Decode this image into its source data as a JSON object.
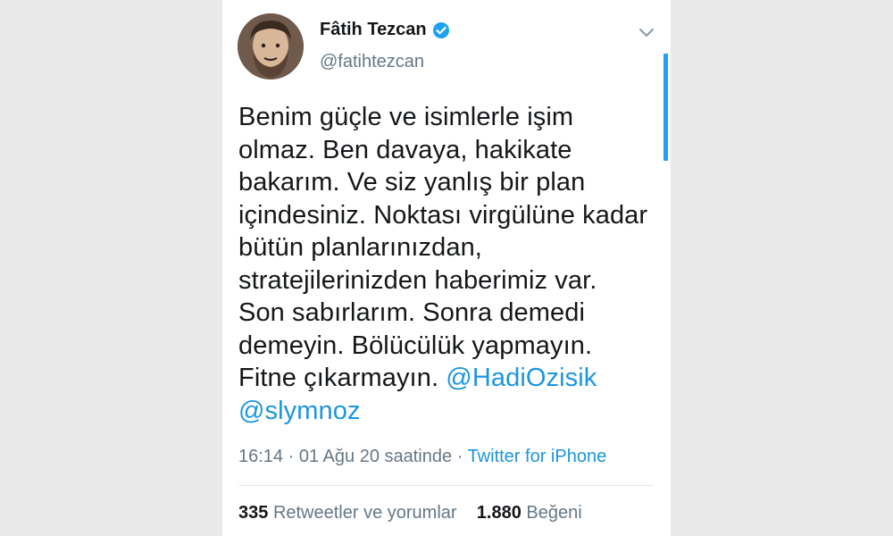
{
  "user": {
    "display_name": "Fâtih Tezcan",
    "handle": "@fatihtezcan",
    "verified": true
  },
  "tweet": {
    "text": "Benim güçle ve isimlerle işim olmaz. Ben davaya, hakikate bakarım. Ve siz yanlış bir plan içindesiniz. Noktası virgülüne kadar bütün planlarınızdan, stratejilerinizden haberimiz var. Son sabırlarım. Sonra demedi demeyin. Bölücülük yapmayın. Fitne çıkarmayın.",
    "mentions": [
      "@HadiOzisik",
      "@slymnoz"
    ]
  },
  "meta": {
    "time": "16:14",
    "separator": "·",
    "date": "01 Ağu 20 saatinde",
    "source": "Twitter for iPhone"
  },
  "stats": {
    "retweets_count": "335",
    "retweets_label": "Retweetler ve yorumlar",
    "likes_count": "1.880",
    "likes_label": "Beğeni"
  },
  "colors": {
    "accent": "#1b95e0",
    "text": "#14171a",
    "secondary": "#657786",
    "background": "#e9e9e9"
  },
  "icons": {
    "verified": "verified-badge-icon",
    "menu": "chevron-down-icon"
  }
}
